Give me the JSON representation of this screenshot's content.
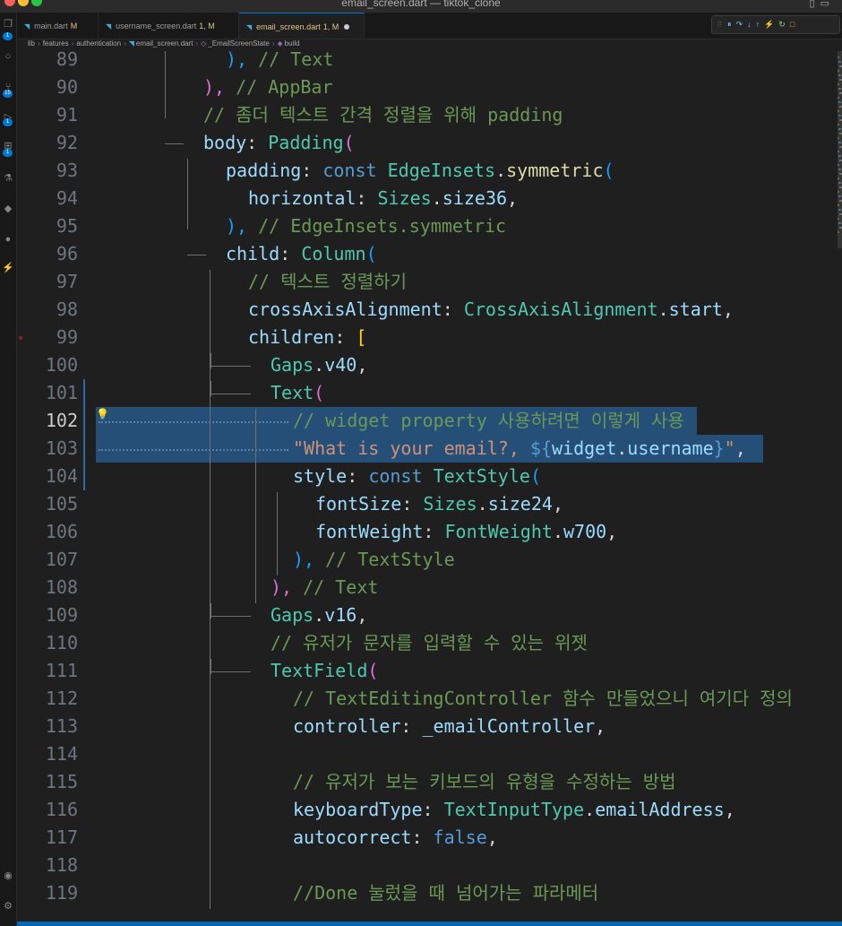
{
  "window": {
    "title": "email_screen.dart — tiktok_clone"
  },
  "tabs": [
    {
      "name": "main.dart",
      "status": "M"
    },
    {
      "name": "username_screen.dart",
      "status": "1, M"
    },
    {
      "name": "email_screen.dart",
      "status": "1, M"
    }
  ],
  "breadcrumb": [
    "lib",
    "features",
    "authentication",
    "email_screen.dart",
    "_EmailScreenState",
    "build"
  ],
  "activity_badges": [
    "1",
    "15",
    "1",
    "1"
  ],
  "editor": {
    "active_line": "102",
    "line_numbers": [
      "89",
      "90",
      "91",
      "92",
      "93",
      "94",
      "95",
      "96",
      "97",
      "98",
      "99",
      "100",
      "101",
      "102",
      "103",
      "104",
      "105",
      "106",
      "107",
      "108",
      "109",
      "110",
      "111",
      "112",
      "113",
      "114",
      "115",
      "116",
      "117",
      "118",
      "119"
    ],
    "lines": [
      [
        "), ",
        "// Text"
      ],
      [
        "), ",
        "// AppBar"
      ],
      [
        "// 좀더 텍스트 간격 정렬을 위해 padding"
      ],
      [
        "body",
        ": ",
        "Padding",
        "("
      ],
      [
        "padding",
        ": ",
        "const ",
        "EdgeInsets",
        ".",
        "symmetric",
        "("
      ],
      [
        "horizontal",
        ": ",
        "Sizes",
        ".",
        "size36",
        ","
      ],
      [
        "), ",
        "// EdgeInsets.symmetric"
      ],
      [
        "child",
        ": ",
        "Column",
        "("
      ],
      [
        "// 텍스트 정렬하기"
      ],
      [
        "crossAxisAlignment",
        ": ",
        "CrossAxisAlignment",
        ".",
        "start",
        ","
      ],
      [
        "children",
        ": ",
        "["
      ],
      [
        "Gaps",
        ".",
        "v40",
        ","
      ],
      [
        "Text",
        "("
      ],
      [
        "// widget property 사용하려면 이렇게 사용"
      ],
      [
        "\"What is your email?, ",
        "${",
        "widget",
        ".",
        "username",
        "}",
        "\"",
        ","
      ],
      [
        "style",
        ": ",
        "const ",
        "TextStyle",
        "("
      ],
      [
        "fontSize",
        ": ",
        "Sizes",
        ".",
        "size24",
        ","
      ],
      [
        "fontWeight",
        ": ",
        "FontWeight",
        ".",
        "w700",
        ","
      ],
      [
        "), ",
        "// TextStyle"
      ],
      [
        "), ",
        "// Text"
      ],
      [
        "Gaps",
        ".",
        "v16",
        ","
      ],
      [
        "// 유저가 문자를 입력할 수 있는 위젯"
      ],
      [
        "TextField",
        "("
      ],
      [
        "// TextEditingController 함수 만들었으니 여기다 정의"
      ],
      [
        "controller",
        ": ",
        "_emailController",
        ","
      ],
      [
        ""
      ],
      [
        "// 유저가 보는 키보드의 유형을 수정하는 방법"
      ],
      [
        "keyboardType",
        ": ",
        "TextInputType",
        ".",
        "emailAddress",
        ","
      ],
      [
        "autocorrect",
        ": ",
        "false",
        ","
      ],
      [
        ""
      ],
      [
        "//Done 눌렀을 때 넘어가는 파라메터"
      ]
    ]
  },
  "colors": {
    "keyword": "#569cd6",
    "type": "#4ec9b0",
    "property": "#9cdcfe",
    "method": "#dcdcaa",
    "comment": "#6a9955",
    "string": "#ce9178",
    "selection": "#264f78",
    "accent": "#0078d4"
  }
}
